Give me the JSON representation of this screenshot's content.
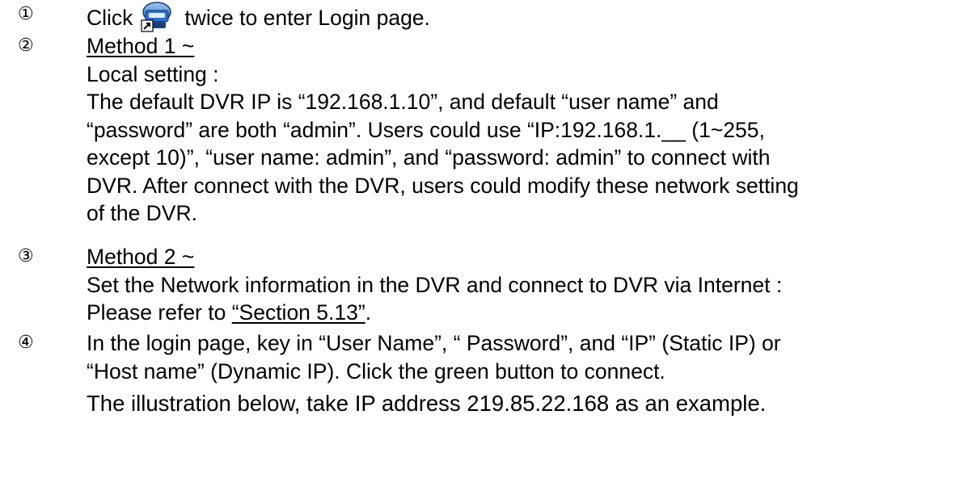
{
  "steps": [
    {
      "marker": "①",
      "text_before_icon": "Click",
      "icon": "dvr-viewer-shortcut-icon",
      "text_after_icon": "twice to enter Login page."
    },
    {
      "marker": "②",
      "heading": "Method 1 ~",
      "subheading": "Local setting :",
      "paragraph_lines": [
        "The default DVR IP is “192.168.1.10”, and default “user name” and",
        "“password” are both “admin”. Users could use “IP:192.168.1.__ (1~255,",
        "except 10)”, “user name: admin”, and “password: admin” to connect with",
        "DVR. After connect with the DVR, users could modify these network setting",
        "of the DVR."
      ]
    },
    {
      "marker": "③",
      "heading": "Method 2 ~",
      "line1": "Set the Network information in the DVR and connect to DVR via Internet :",
      "line2_prefix": "Please refer to ",
      "line2_link": "“Section 5.13”",
      "line2_suffix": "."
    },
    {
      "marker": "④",
      "lines": [
        "In the login page, key in “User Name”, “ Password”, and “IP” (Static IP) or",
        "“Host name” (Dynamic IP). Click the green button to connect."
      ],
      "example": "The illustration below, take IP address 219.85.22.168 as an example."
    }
  ],
  "colors": {
    "text": "#000000",
    "icon_blue": "#2f6fc9",
    "icon_dark": "#1a3f7a"
  }
}
